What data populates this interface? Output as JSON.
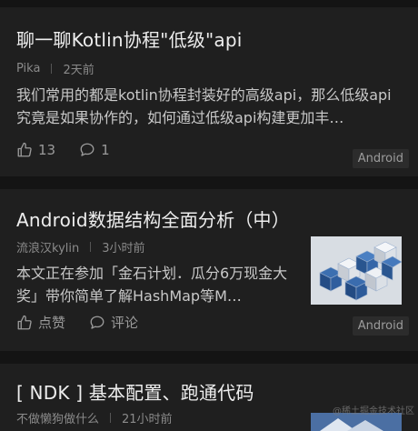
{
  "articles": [
    {
      "title": "聊一聊Kotlin协程\"低级\"api",
      "author": "Pika",
      "time": "2天前",
      "summary": "我们常用的都是kotlin协程封装好的高级api，那么低级api究竟是如果协作的，如何通过低级api构建更加丰…",
      "likes": "13",
      "comments": "1",
      "tag": "Android"
    },
    {
      "title": "Android数据结构全面分析（中）",
      "author": "流浪汉kylin",
      "time": "3小时前",
      "summary": "本文正在参加「金石计划．瓜分6万现金大奖」带你简单了解HashMap等M…",
      "likes": "点赞",
      "comments": "评论",
      "tag": "Android"
    },
    {
      "title": "[ NDK ] 基本配置、跑通代码",
      "author": "不做懒狗做什么",
      "time": "21小时前"
    }
  ],
  "watermark": "@稀土掘金技术社区",
  "icons": {
    "like": "thumbs-up-icon",
    "comment": "comment-bubble-icon"
  }
}
